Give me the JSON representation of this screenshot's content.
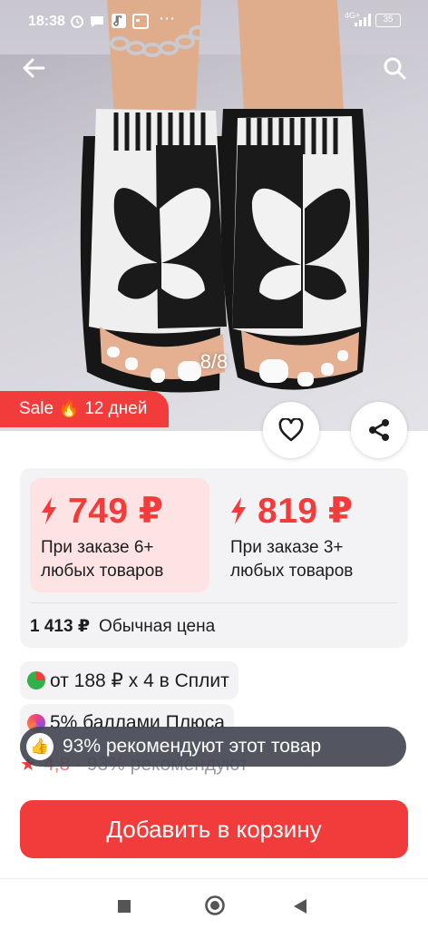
{
  "status_bar": {
    "time": "18:38",
    "network": "4G+",
    "battery": "35"
  },
  "gallery": {
    "counter": "8/8"
  },
  "sale_badge": {
    "text": "Sale 🔥 12 дней"
  },
  "prices": [
    {
      "amount": "749 ₽",
      "condition": "При заказе 6+ любых товаров"
    },
    {
      "amount": "819 ₽",
      "condition": "При заказе 3+ любых товаров"
    }
  ],
  "regular_price": {
    "amount": "1 413 ₽",
    "label": "Обычная цена"
  },
  "split": {
    "text": "от 188 ₽ x 4 в Сплит"
  },
  "plus": {
    "text": "5% баллами Плюса"
  },
  "rating": {
    "value": "4,8",
    "text": "· 93% рекомендуют"
  },
  "toast": {
    "text": "93% рекомендуют этот товар"
  },
  "cart_button": {
    "label": "Добавить в корзину"
  },
  "colors": {
    "accent": "#f23c3c",
    "price_bg": "#fde3e3",
    "card_bg": "#f3f3f6",
    "toast_bg": "#464854"
  }
}
